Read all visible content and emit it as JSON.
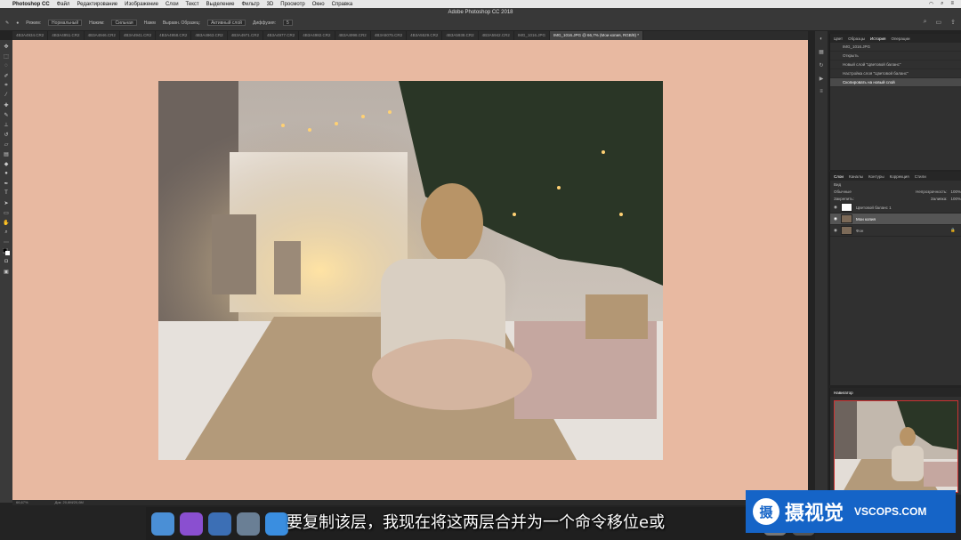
{
  "menubar": {
    "app": "Photoshop CC",
    "items": [
      "Файл",
      "Редактирование",
      "Изображение",
      "Слои",
      "Текст",
      "Выделение",
      "Фильтр",
      "3D",
      "Просмотр",
      "Окно",
      "Справка"
    ]
  },
  "window_title": "Adobe Photoshop CC 2018",
  "options": {
    "mode_label": "Режим:",
    "mode_value": "Нормальный",
    "opacity_label": "Нажим:",
    "opacity_value": "Сильная",
    "flow_label": "Нажм",
    "sample_label": "Выравн. Образец:",
    "sample_value": "Активный слой",
    "diffusion_label": "Диффузия:",
    "diffusion_value": "5"
  },
  "tabs": [
    {
      "label": "4B3A4934.CR2",
      "active": false
    },
    {
      "label": "4B3A4951.CR2",
      "active": false
    },
    {
      "label": "4B3A4946.CR2",
      "active": false
    },
    {
      "label": "4B3A4941.CR2",
      "active": false
    },
    {
      "label": "4B3A4958.CR2",
      "active": false
    },
    {
      "label": "4B3A4963.CR2",
      "active": false
    },
    {
      "label": "4B3A4971.CR2",
      "active": false
    },
    {
      "label": "4B3A4977.CR2",
      "active": false
    },
    {
      "label": "4B3A4982.CR2",
      "active": false
    },
    {
      "label": "4B3A4998.CR2",
      "active": false
    },
    {
      "label": "4B3A5075.CR2",
      "active": false
    },
    {
      "label": "4B3A5529.CR2",
      "active": false
    },
    {
      "label": "4B3A5938.CR2",
      "active": false
    },
    {
      "label": "4B3A5942.CR2",
      "active": false
    },
    {
      "label": "IMG_1016.JPG",
      "active": false
    },
    {
      "label": "IMG_1016.JPG @ 66,7% (Мои копия, RGB/8) *",
      "active": true
    }
  ],
  "history_panel": {
    "tabs": [
      "Цвет",
      "Образцы",
      "История",
      "Операции"
    ],
    "active_tab": "История",
    "snapshot": "IMG_1016.JPG",
    "items": [
      {
        "label": "Открыть",
        "selected": false
      },
      {
        "label": "Новый слой \"Цветовой баланс\"",
        "selected": false
      },
      {
        "label": "Настройка слоя \"Цветовой баланс\"",
        "selected": false
      },
      {
        "label": "Скопировать на новый слой",
        "selected": true
      }
    ]
  },
  "layers_panel": {
    "tabs": [
      "Слои",
      "Каналы",
      "Контуры",
      "Коррекция",
      "Стили"
    ],
    "active_tab": "Слои",
    "filter": "Вид",
    "blend_mode": "Обычные",
    "opacity_label": "Непрозрачность:",
    "opacity_value": "100%",
    "lock_label": "Закрепить:",
    "fill_label": "Заливка:",
    "fill_value": "100%",
    "layers": [
      {
        "name": "Цветовой баланс 1",
        "selected": false
      },
      {
        "name": "Мои копия",
        "selected": true
      },
      {
        "name": "Фон",
        "selected": false
      }
    ]
  },
  "navigator": {
    "title": "Навигатор"
  },
  "status": {
    "zoom": "66,67%",
    "doc": "Док: 20,6M/20,6M"
  },
  "subtitle": "要复制该层，我现在将这两层合并为一个命令移位e或",
  "watermark": {
    "logo_char": "摄",
    "cn": "摄视觉",
    "en": "VSCOPS.COM"
  }
}
